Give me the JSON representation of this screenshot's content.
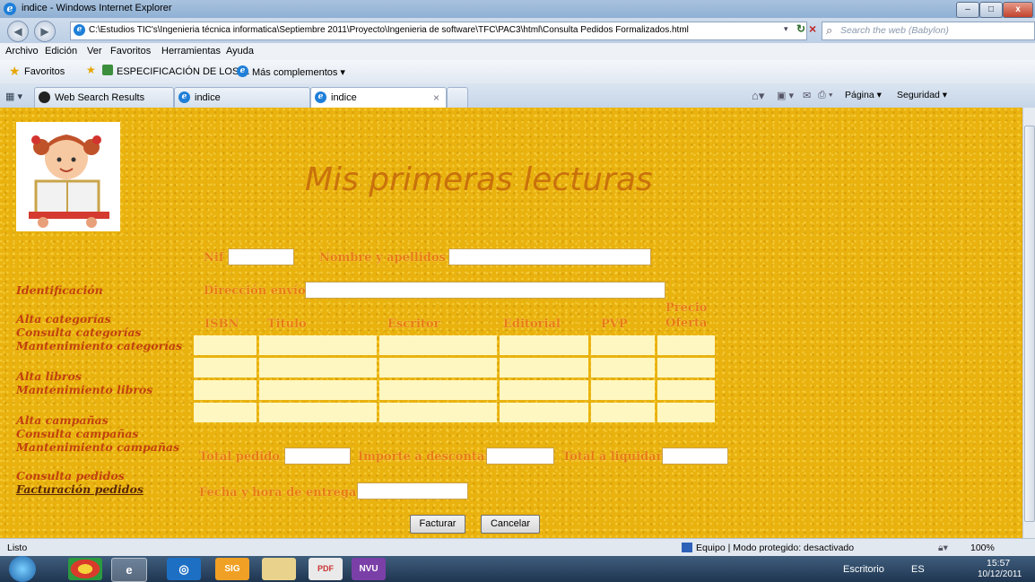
{
  "window": {
    "title": "indice - Windows Internet Explorer",
    "buttons": {
      "minimize": "–",
      "maximize": "□",
      "close": "x"
    }
  },
  "address_bar": {
    "url": "C:\\Estudios TIC's\\Ingenieria técnica informatica\\Septiembre 2011\\Proyecto\\Ingenieria de software\\TFC\\PAC3\\html\\Consulta Pedidos Formalizados.html",
    "search_placeholder": "Search the web (Babylon)"
  },
  "menu": [
    "Archivo",
    "Edición",
    "Ver",
    "Favoritos",
    "Herramientas",
    "Ayuda"
  ],
  "favorites_bar": {
    "favorites_label": "Favoritos",
    "items": [
      "ESPECIFICACIÓN DE LOS ...",
      "Más complementos ▾"
    ]
  },
  "tabs": [
    {
      "label": "Web Search Results"
    },
    {
      "label": "indice"
    },
    {
      "label": "indice",
      "active": true
    }
  ],
  "command_bar": {
    "page": "Página ▾",
    "security": "Seguridad ▾"
  },
  "page": {
    "site_title": "Mis primeras lecturas",
    "form": {
      "nif_label": "Nif",
      "name_label": "Nombre  y apellidos",
      "address_label": "Dirección envío",
      "total_pedido_label": "Total pedido",
      "importe_label": "Importe a descontar",
      "total_liquidar_label": "Total a liquidar",
      "fecha_label": "Fecha y hora de entrega"
    },
    "table_headers": [
      "ISBN",
      "Titulo",
      "Escritor",
      "Editorial",
      "PVP",
      "Precio\nOferta"
    ],
    "sidebar": [
      "Identificación",
      "Alta categorías",
      "Consulta categorías",
      "Mantenimiento categorías",
      "Alta libros",
      "Mantenimiento libros",
      "Alta  campañas",
      "Consulta  campañas",
      "Mantenimiento  campañas",
      "Consulta pedidos",
      "Facturación pedidos"
    ],
    "buttons": {
      "facturar": "Facturar",
      "cancelar": "Cancelar"
    }
  },
  "status_bar": {
    "status": "Listo",
    "zone": "Equipo | Modo protegido: desactivado",
    "zoom": "100%"
  },
  "taskbar": {
    "desktop": "Escritorio",
    "lang": "ES",
    "time": "15:57",
    "date": "10/12/2011"
  }
}
